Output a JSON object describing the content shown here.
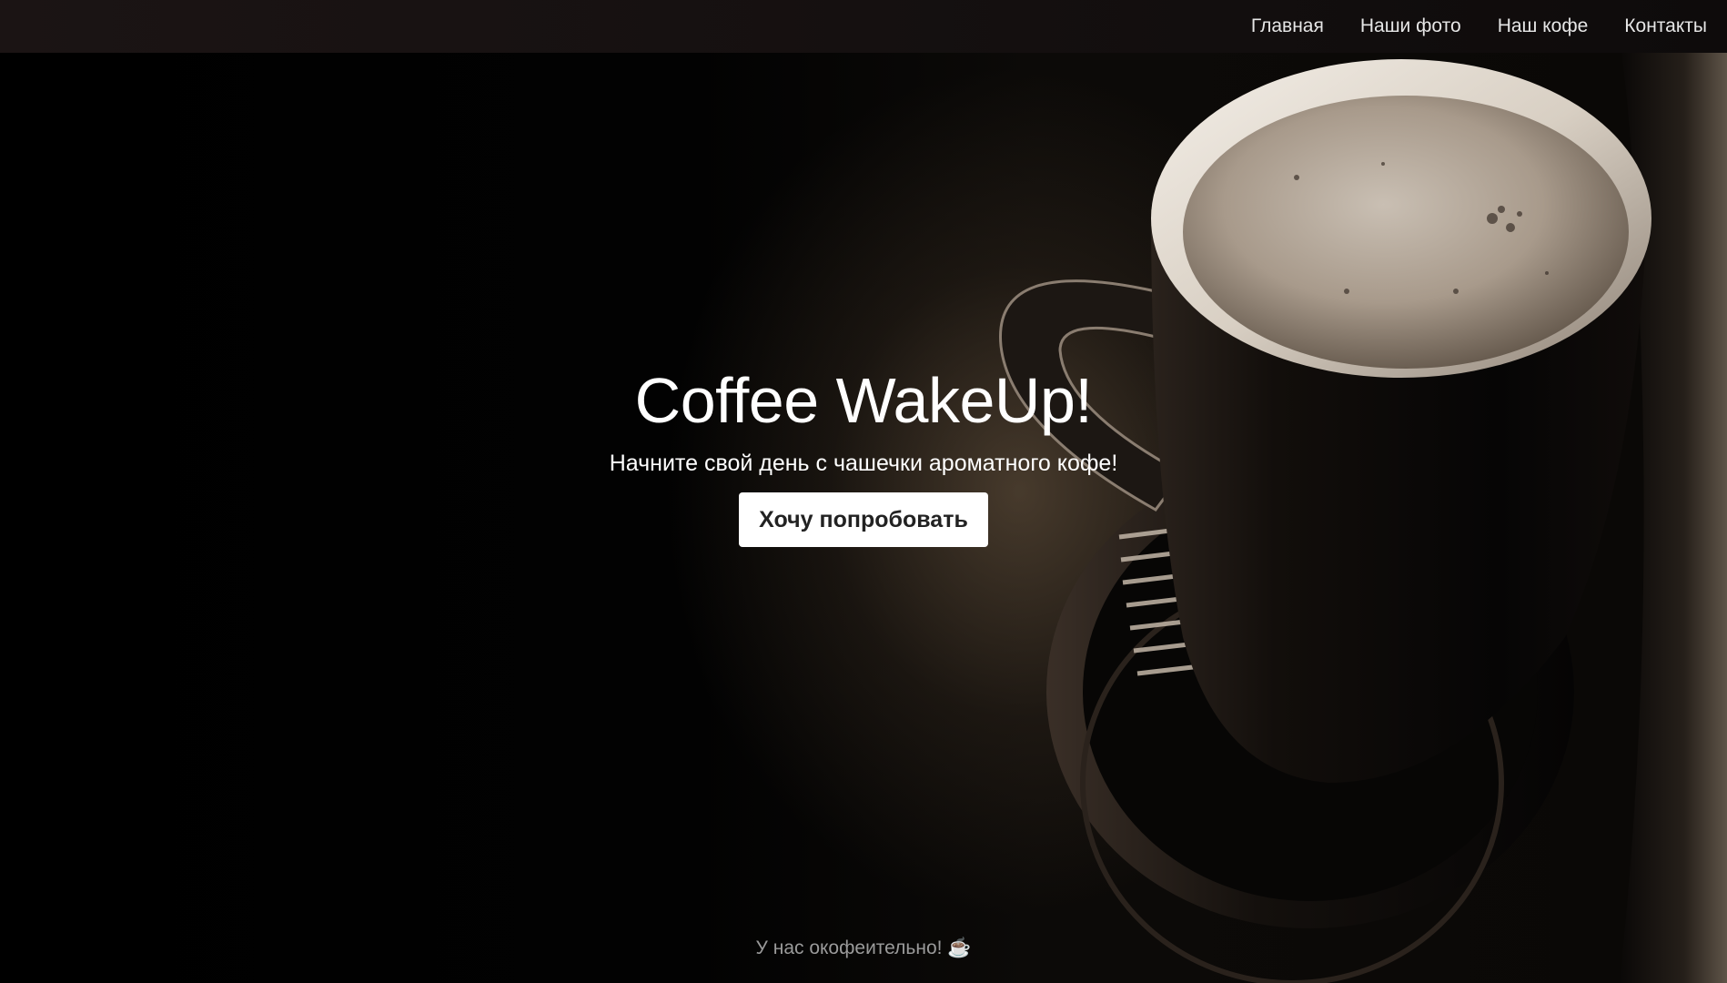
{
  "nav": {
    "items": [
      {
        "label": "Главная"
      },
      {
        "label": "Наши фото"
      },
      {
        "label": "Наш кофе"
      },
      {
        "label": "Контакты"
      }
    ]
  },
  "hero": {
    "title": "Coffee WakeUp!",
    "subtitle": "Начните свой день с чашечки ароматного кофе!",
    "cta_label": "Хочу попробовать"
  },
  "footer": {
    "note": "У нас окофеительно! ☕"
  },
  "colors": {
    "background": "#000000",
    "navbar": "#1b1414",
    "button_bg": "#ffffff",
    "button_text": "#222222"
  }
}
